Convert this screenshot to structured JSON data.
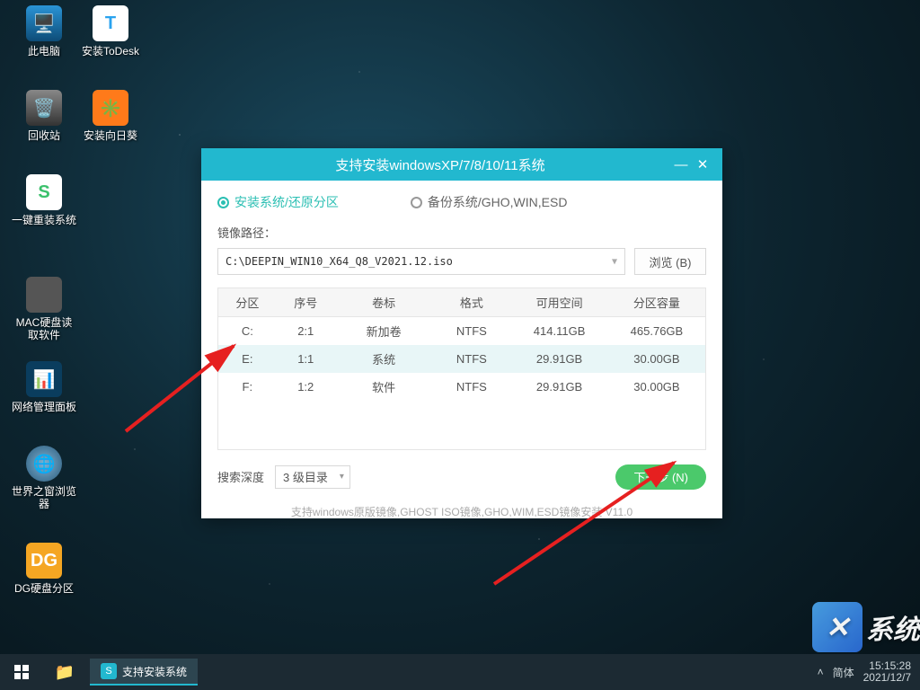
{
  "desktop_icons": {
    "this_pc": "此电脑",
    "install_todesk": "安装ToDesk",
    "recycle": "回收站",
    "install_sunflower": "安装向日葵",
    "one_click_reinstall": "一键重装系统",
    "mac_disk_reader": "MAC硬盘读取软件",
    "network_panel": "网络管理面板",
    "world_browser": "世界之窗浏览器",
    "dg_disk": "DG硬盘分区"
  },
  "dialog": {
    "title": "支持安装windowsXP/7/8/10/11系统",
    "radio_install": "安装系统/还原分区",
    "radio_backup": "备份系统/GHO,WIN,ESD",
    "image_path_label": "镜像路径：",
    "image_path": "C:\\DEEPIN_WIN10_X64_Q8_V2021.12.iso",
    "browse": "浏览 (B)",
    "columns": {
      "partition": "分区",
      "index": "序号",
      "volume": "卷标",
      "format": "格式",
      "free": "可用空间",
      "capacity": "分区容量"
    },
    "rows": [
      {
        "part": "C:",
        "idx": "2:1",
        "vol": "新加卷",
        "fmt": "NTFS",
        "free": "414.11GB",
        "cap": "465.76GB"
      },
      {
        "part": "E:",
        "idx": "1:1",
        "vol": "系统",
        "fmt": "NTFS",
        "free": "29.91GB",
        "cap": "30.00GB"
      },
      {
        "part": "F:",
        "idx": "1:2",
        "vol": "软件",
        "fmt": "NTFS",
        "free": "29.91GB",
        "cap": "30.00GB"
      }
    ],
    "search_depth_label": "搜索深度",
    "search_depth_value": "3 级目录",
    "next": "下一步 (N)",
    "hint": "支持windows原版镜像,GHOST ISO镜像,GHO,WIM,ESD镜像安装  V11.0"
  },
  "taskbar": {
    "app_label": "支持安装系统",
    "ime": "简体",
    "time": "15:15:28",
    "date": "2021/12/7"
  },
  "watermark": "系统"
}
